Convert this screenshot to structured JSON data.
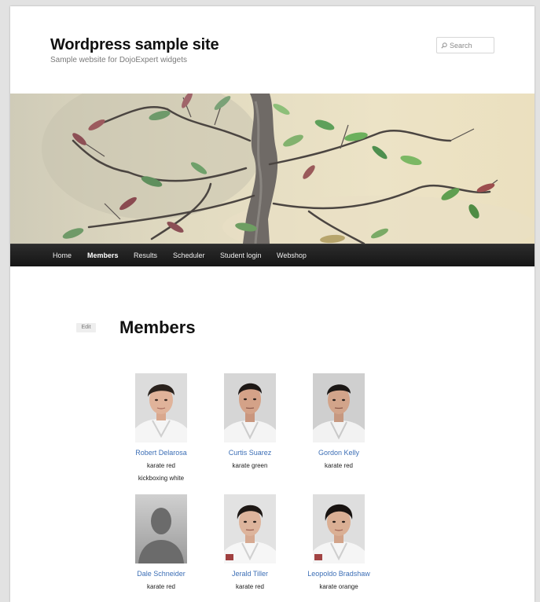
{
  "site": {
    "title": "Wordpress sample site",
    "description": "Sample website for DojoExpert widgets"
  },
  "search": {
    "placeholder": "Search"
  },
  "nav": {
    "items": [
      {
        "label": "Home"
      },
      {
        "label": "Members"
      },
      {
        "label": "Results"
      },
      {
        "label": "Scheduler"
      },
      {
        "label": "Student login"
      },
      {
        "label": "Webshop"
      }
    ]
  },
  "page": {
    "edit_label": "Edit",
    "title": "Members"
  },
  "members": [
    {
      "name": "Robert Delarosa",
      "ranks": [
        "karate red",
        "kickboxing white"
      ]
    },
    {
      "name": "Curtis Suarez",
      "ranks": [
        "karate green"
      ]
    },
    {
      "name": "Gordon Kelly",
      "ranks": [
        "karate red"
      ]
    },
    {
      "name": "Dale Schneider",
      "ranks": [
        "karate red"
      ]
    },
    {
      "name": "Jerald Tiller",
      "ranks": [
        "karate red"
      ]
    },
    {
      "name": "Leopoldo Bradshaw",
      "ranks": [
        "karate orange"
      ]
    }
  ]
}
